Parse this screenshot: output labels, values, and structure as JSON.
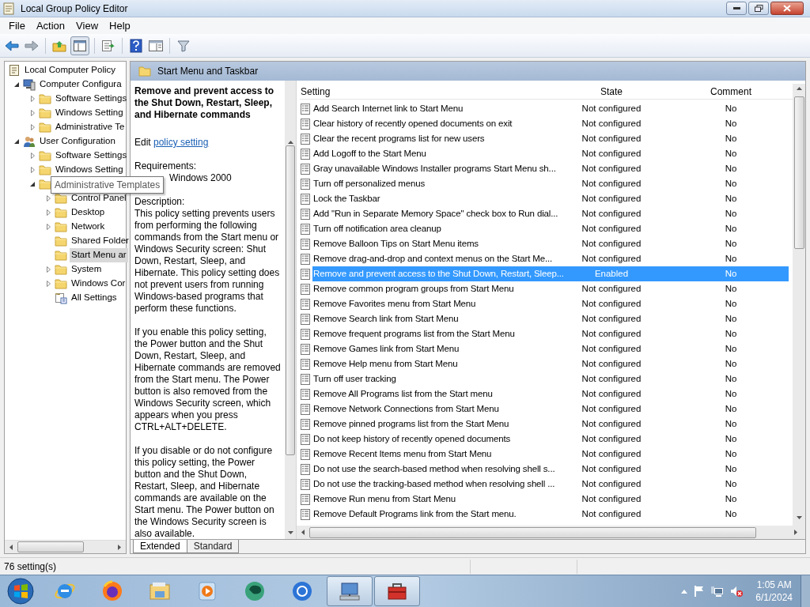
{
  "window": {
    "title": "Local Group Policy Editor"
  },
  "menu": [
    "File",
    "Action",
    "View",
    "Help"
  ],
  "tree": [
    {
      "label": "Local Computer Policy",
      "kind": "policy",
      "expandable": false,
      "selected": false,
      "children": [
        {
          "label": "Computer Configura",
          "kind": "computer",
          "expandable": true,
          "expanded": true,
          "selected": false,
          "children": [
            {
              "label": "Software Settings",
              "kind": "folder",
              "expandable": true,
              "expanded": false,
              "selected": false
            },
            {
              "label": "Windows Setting",
              "kind": "folder",
              "expandable": true,
              "expanded": false,
              "selected": false
            },
            {
              "label": "Administrative Te",
              "kind": "folder",
              "expandable": true,
              "expanded": false,
              "selected": false
            }
          ]
        },
        {
          "label": "User Configuration",
          "kind": "users",
          "expandable": true,
          "expanded": true,
          "selected": false,
          "children": [
            {
              "label": "Software Settings",
              "kind": "folder",
              "expandable": true,
              "expanded": false,
              "selected": false
            },
            {
              "label": "Windows Setting",
              "kind": "folder",
              "expandable": true,
              "expanded": false,
              "selected": false
            },
            {
              "tooltip": "Administrative Templates",
              "kind": "folder",
              "expandable": true,
              "expanded": true,
              "children": [
                {
                  "label": "Control Panel",
                  "kind": "folder",
                  "expandable": true,
                  "expanded": false,
                  "selected": false
                },
                {
                  "label": "Desktop",
                  "kind": "folder",
                  "expandable": true,
                  "expanded": false,
                  "selected": false
                },
                {
                  "label": "Network",
                  "kind": "folder",
                  "expandable": true,
                  "expanded": false,
                  "selected": false
                },
                {
                  "label": "Shared Folder",
                  "kind": "folder",
                  "expandable": false,
                  "selected": false
                },
                {
                  "label": "Start Menu ar",
                  "kind": "folder",
                  "expandable": false,
                  "selected": true
                },
                {
                  "label": "System",
                  "kind": "folder",
                  "expandable": true,
                  "expanded": false,
                  "selected": false
                },
                {
                  "label": "Windows Cor",
                  "kind": "folder",
                  "expandable": true,
                  "expanded": false,
                  "selected": false
                },
                {
                  "label": "All Settings",
                  "kind": "settings",
                  "expandable": false,
                  "selected": false
                }
              ]
            }
          ]
        }
      ]
    }
  ],
  "header": {
    "title": "Start Menu and Taskbar"
  },
  "description": {
    "title": "Remove and prevent access to the Shut Down, Restart, Sleep, and Hibernate commands",
    "edit_prefix": "Edit",
    "edit_link": "policy setting",
    "requirements_label": "Requirements:",
    "requirements": "Windows 2000",
    "description_label": "Description:",
    "paragraphs": [
      "This policy setting prevents users from performing the following commands from the Start menu or Windows Security screen: Shut Down, Restart, Sleep, and Hibernate. This policy setting does not prevent users from running Windows-based programs that perform these functions.",
      "If you enable this policy setting, the Power button and the Shut Down, Restart, Sleep, and Hibernate commands are removed from the Start menu. The Power button is also removed from the Windows Security screen, which appears when you press CTRL+ALT+DELETE.",
      "If you disable or do not configure this policy setting, the Power button and the Shut Down, Restart, Sleep, and Hibernate commands are available on the Start menu. The Power button on the Windows Security screen is also available."
    ]
  },
  "table": {
    "columns": [
      "Setting",
      "State",
      "Comment"
    ],
    "rows": [
      {
        "setting": "Add Search Internet link to Start Menu",
        "state": "Not configured",
        "comment": "No",
        "selected": false
      },
      {
        "setting": "Clear history of recently opened documents on exit",
        "state": "Not configured",
        "comment": "No",
        "selected": false
      },
      {
        "setting": "Clear the recent programs list for new users",
        "state": "Not configured",
        "comment": "No",
        "selected": false
      },
      {
        "setting": "Add Logoff to the Start Menu",
        "state": "Not configured",
        "comment": "No",
        "selected": false
      },
      {
        "setting": "Gray unavailable Windows Installer programs Start Menu sh...",
        "state": "Not configured",
        "comment": "No",
        "selected": false
      },
      {
        "setting": "Turn off personalized menus",
        "state": "Not configured",
        "comment": "No",
        "selected": false
      },
      {
        "setting": "Lock the Taskbar",
        "state": "Not configured",
        "comment": "No",
        "selected": false
      },
      {
        "setting": "Add \"Run in Separate Memory Space\" check box to Run dial...",
        "state": "Not configured",
        "comment": "No",
        "selected": false
      },
      {
        "setting": "Turn off notification area cleanup",
        "state": "Not configured",
        "comment": "No",
        "selected": false
      },
      {
        "setting": "Remove Balloon Tips on Start Menu items",
        "state": "Not configured",
        "comment": "No",
        "selected": false
      },
      {
        "setting": "Remove drag-and-drop and context menus on the Start Me...",
        "state": "Not configured",
        "comment": "No",
        "selected": false
      },
      {
        "setting": "Remove and prevent access to the Shut Down, Restart, Sleep...",
        "state": "Enabled",
        "comment": "No",
        "selected": true
      },
      {
        "setting": "Remove common program groups from Start Menu",
        "state": "Not configured",
        "comment": "No",
        "selected": false
      },
      {
        "setting": "Remove Favorites menu from Start Menu",
        "state": "Not configured",
        "comment": "No",
        "selected": false
      },
      {
        "setting": "Remove Search link from Start Menu",
        "state": "Not configured",
        "comment": "No",
        "selected": false
      },
      {
        "setting": "Remove frequent programs list from the Start Menu",
        "state": "Not configured",
        "comment": "No",
        "selected": false
      },
      {
        "setting": "Remove Games link from Start Menu",
        "state": "Not configured",
        "comment": "No",
        "selected": false
      },
      {
        "setting": "Remove Help menu from Start Menu",
        "state": "Not configured",
        "comment": "No",
        "selected": false
      },
      {
        "setting": "Turn off user tracking",
        "state": "Not configured",
        "comment": "No",
        "selected": false
      },
      {
        "setting": "Remove All Programs list from the Start menu",
        "state": "Not configured",
        "comment": "No",
        "selected": false
      },
      {
        "setting": "Remove Network Connections from Start Menu",
        "state": "Not configured",
        "comment": "No",
        "selected": false
      },
      {
        "setting": "Remove pinned programs list from the Start Menu",
        "state": "Not configured",
        "comment": "No",
        "selected": false
      },
      {
        "setting": "Do not keep history of recently opened documents",
        "state": "Not configured",
        "comment": "No",
        "selected": false
      },
      {
        "setting": "Remove Recent Items menu from Start Menu",
        "state": "Not configured",
        "comment": "No",
        "selected": false
      },
      {
        "setting": "Do not use the search-based method when resolving shell s...",
        "state": "Not configured",
        "comment": "No",
        "selected": false
      },
      {
        "setting": "Do not use the tracking-based method when resolving shell ...",
        "state": "Not configured",
        "comment": "No",
        "selected": false
      },
      {
        "setting": "Remove Run menu from Start Menu",
        "state": "Not configured",
        "comment": "No",
        "selected": false
      },
      {
        "setting": "Remove Default Programs link from the Start menu.",
        "state": "Not configured",
        "comment": "No",
        "selected": false
      }
    ]
  },
  "view_tabs": [
    {
      "label": "Extended",
      "selected": true
    },
    {
      "label": "Standard",
      "selected": false
    }
  ],
  "status_bar": "76 setting(s)",
  "taskbar": {
    "apps": [
      {
        "kind": "ie",
        "active": false
      },
      {
        "kind": "firefox",
        "active": false
      },
      {
        "kind": "explorer",
        "active": false
      },
      {
        "kind": "media",
        "active": false
      },
      {
        "kind": "chat",
        "active": false
      },
      {
        "kind": "chrome",
        "active": false
      },
      {
        "kind": "mmc",
        "active": true
      },
      {
        "kind": "toolbox",
        "active": true
      }
    ],
    "time": "1:05 AM",
    "date": "6/1/2024"
  }
}
